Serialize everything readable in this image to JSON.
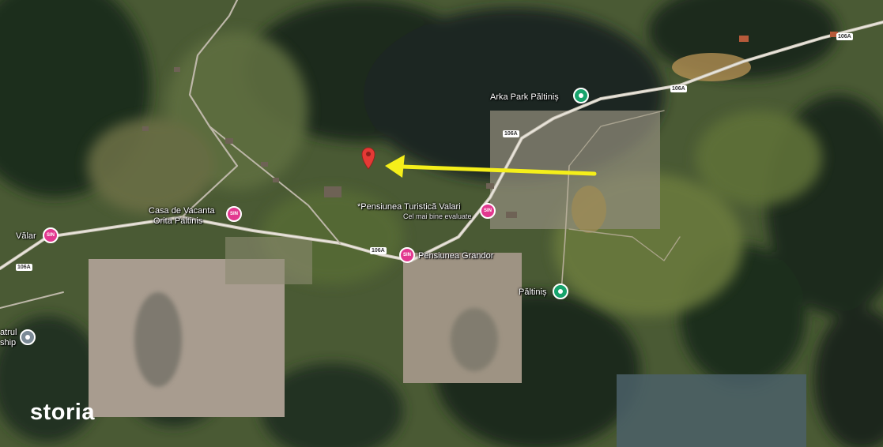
{
  "map": {
    "type": "satellite",
    "road_code": "106A",
    "places": [
      {
        "name": "Arka Park Păltiniș",
        "kind": "park"
      },
      {
        "name": "*Pensiunea Turistică Valari",
        "kind": "hotel",
        "note": "Cel mai bine evaluate"
      },
      {
        "name": "Casa de Vacanta Orita Paltinis",
        "kind": "hotel",
        "line1": "Casa de Vacanta",
        "line2": "Orita Paltinis"
      },
      {
        "name": "Pensiunea Grandor",
        "kind": "hotel"
      },
      {
        "name": "Păltiniș",
        "kind": "park"
      },
      {
        "name": "Vălar",
        "kind": "hotel"
      },
      {
        "name": "atrul ship",
        "kind": "grey",
        "line1": "atrul",
        "line2": "ship"
      }
    ],
    "hotel_icon_text": "SIN",
    "arrow_color": "#f5ef1a",
    "pin_color": "#e53935"
  },
  "watermark": "storia"
}
